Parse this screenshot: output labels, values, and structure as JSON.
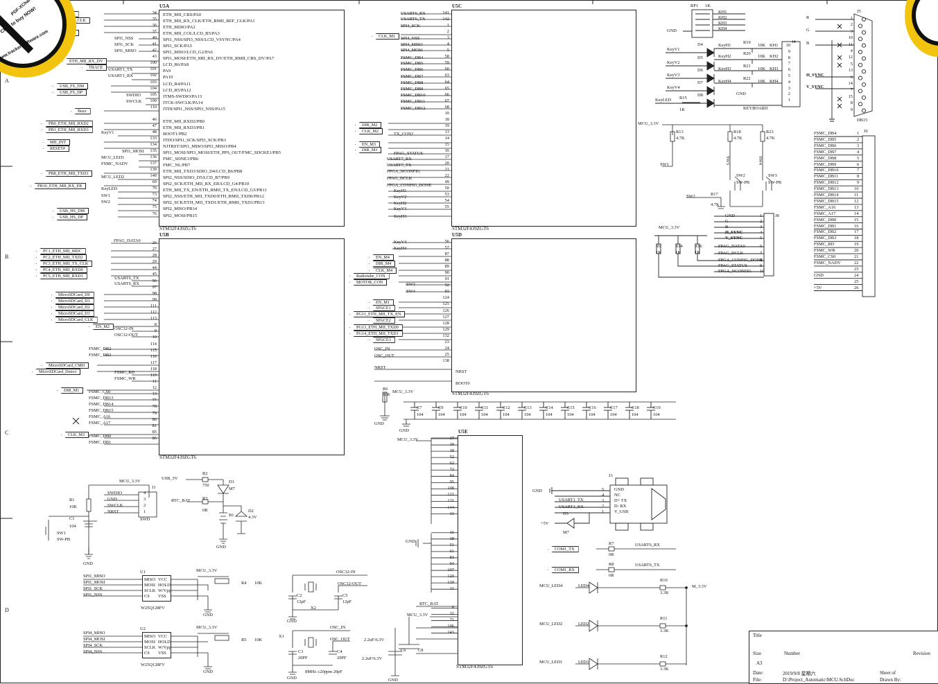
{
  "watermark": {
    "text": "Click to buy NOW!",
    "url_text": "www.tracker-software.com",
    "brand": "PDF-XChange"
  },
  "zones": [
    "A",
    "B",
    "C",
    "D"
  ],
  "u5a": {
    "title": "U5A",
    "part": "STM32F439ZGT6",
    "pins": [
      "ETH_MII_CRS/PA0",
      "ETH_MII_RX_CLK/ETH_RMII_REF_CLK/PA1",
      "ETH_MDIO/PA2",
      "ETH_MII_COL/LCD_B5/PA3",
      "SPI1_NSS/SPI3_NSS/LCD_VSYNC/PA4",
      "SPI1_SCK/PA5",
      "SPI1_MISO/LCD_G2/PA6",
      "SPI1_MOSI/ETH_MII_RX_DV/ETH_RMII_CRS_DV/PA7",
      "LCD_R6/PA8",
      "PA9",
      "PA10",
      "LCD_R4/PA11",
      "LCD_R5/PA12",
      "JTMS-SWDIO/PA13",
      "JTCK-SWCLK/PA14",
      "JTDI/SPI1_NSS/SPI3_NSS/PA15",
      "",
      "ETH_MII_RXD2/PB0",
      "ETH_MII_RXD3/PB1",
      "BOOT1/PB2",
      "JTDO/SPI1_SCK/SPI3_SCK/PB3",
      "NJTRST/SPI1_MISO/SPI3_MISO/PB4",
      "SPI1_MOSI/SPI3_MOSI/ETH_PPS_OUT/FMC_SDCKE1/PB5",
      "FMC_SDNE1/PB6",
      "FMC_NL/PB7",
      "ETH_MII_TXD3/SDIO_D4/LCD_B6/PB8",
      "SPI2_NSS/SDIO_D5/LCD_B7/PB9",
      "SPI2_SCK/ETH_MII_RX_ER/LCD_G4/PB10",
      "ETH_MII_TX_EN/ETH_RMII_TX_EN/LCD_G5/PB11",
      "SPI2_NSS/ETH_MII_TXD0/ETH_RMII_TXD0/PB12",
      "SPI2_SCK/ETH_MII_TXD1/ETH_RMII_TXD1/PB13",
      "SPI2_MISO/PB14",
      "SPI2_MOSI/PB15"
    ],
    "nums": [
      "34",
      "35",
      "36",
      "37",
      "40",
      "41",
      "42",
      "43",
      "100",
      "101",
      "102",
      "103",
      "104",
      "105",
      "109",
      "110",
      "",
      "46",
      "47",
      "48",
      "133",
      "134",
      "135",
      "136",
      "137",
      "139",
      "140",
      "69",
      "70",
      "73",
      "74",
      "75",
      "76"
    ]
  },
  "u5a_nets": [
    {
      "t": "ETH_MII_CRS"
    },
    {
      "t": "ETH_MII_RX_CLK"
    },
    {
      "t": "ETH_MDIO"
    },
    {
      "t": "ETH_MII_COL"
    },
    {
      "t": "SPI1_NSS"
    },
    {
      "t": "SPI1_SCK"
    },
    {
      "t": "SPI1_MISO"
    },
    {
      "t": "ETH_MII_RX_DV"
    },
    {
      "t": "TRACE"
    },
    {
      "t": "USART1_TX"
    },
    {
      "t": "USART1_RX"
    },
    {
      "t": "USB_FS_DM"
    },
    {
      "t": "USB_FS_DP"
    },
    {
      "t": "SWDIO"
    },
    {
      "t": "SWCLK"
    },
    {
      "t": "Buzz"
    },
    {
      "t": "PB0_ETH_MII_RXD2"
    },
    {
      "t": "PB1_ETH_MII_RXD3"
    },
    {
      "t": "KeyV1"
    },
    {
      "t": "MII_INT"
    },
    {
      "t": "RESET#"
    },
    {
      "t": "SPI1_MOSI"
    },
    {
      "t": "MCU_LED1"
    },
    {
      "t": "FSMC_NADV"
    },
    {
      "t": "PB8_ETH_MII_TXD3"
    },
    {
      "t": "MCU_LED2"
    },
    {
      "t": "PB10_ETH_MII_RX_ER"
    },
    {
      "t": "KeyLED"
    },
    {
      "t": "SW1"
    },
    {
      "t": "SW2"
    },
    {
      "t": "USB_HS_DM"
    },
    {
      "t": "USB_HS_DP"
    }
  ],
  "u5b": {
    "title": "U5B",
    "part": "STM32F439ZGT6",
    "nets": [
      "FPAG_DATA0",
      "PC1_ETH_MII_MDC",
      "PC2_ETH_MII_TXD2",
      "PC3_ETH_MII_TX_CLK",
      "PC4_ETH_MII_RXD0",
      "PC5_ETH_MII_RXD1",
      "USART6_TX",
      "USART6_RX",
      "MicroSDCard_D0",
      "MicroSDCard_D1",
      "MicroSDCard_D2",
      "MicroSDCard_D3",
      "MicroSDCard_CLK",
      "EN_M2",
      "OSC32-IN",
      "OSC32-OUT",
      "FSMC_DB2",
      "FSMC_DB3",
      "MicroSDCard_CMD",
      "MicroSDCard_Detect",
      "FSMC_RD",
      "FSMC_WR",
      "DIR_M1",
      "FSMC_CS0",
      "FSMC_DB13",
      "FSMC_DB14",
      "FSMC_DB15",
      "FSMC_A16",
      "FSMC_A17",
      "CLK_M3",
      "FSMC_DB0",
      "FSMC_DB1"
    ],
    "nums": [
      "26",
      "27",
      "28",
      "29",
      "44",
      "45",
      "96",
      "97",
      "98",
      "99",
      "111",
      "112",
      "113",
      "8",
      "9",
      "10",
      "114",
      "115",
      "116",
      "117",
      "118",
      "119",
      "11",
      "12",
      "13",
      "77",
      "78",
      "79",
      "80",
      "81",
      "85",
      "86"
    ]
  },
  "u5c": {
    "title": "U5C",
    "part": "STM32F439ZGT6",
    "nets_left": [
      "USART6_RX",
      "USART6_TX",
      "SPI4_SCK",
      "CLK_M1",
      "SPI4_NSS",
      "SPI4_MISO",
      "SPI4_MOSI",
      "FSMC_DB4",
      "FSMC_DB5",
      "FSMC_DB6",
      "FSMC_DB7",
      "FSMC_DB8",
      "FSMC_DB9",
      "FSMC_DB10",
      "FSMC_DB11",
      "FSMC_DB12",
      "DIR_M2",
      "CLK_M2",
      "TX_CON2",
      "EN_M3",
      "DIR_M3",
      "FPAG_STATUS",
      "USART7_RX",
      "USART7_TX",
      "FPGA_NCONFIG",
      "FPAG_DCLK",
      "FPGA_CONFIG_DONE",
      "KeyH1",
      "KeyV2",
      "KeyH2",
      "KeyV3",
      "KeyH3"
    ],
    "nums": [
      "141",
      "142",
      "1",
      "2",
      "3",
      "4",
      "5",
      "58",
      "59",
      "60",
      "63",
      "64",
      "65",
      "66",
      "67",
      "68",
      "10",
      "18",
      "19",
      "13",
      "14",
      "15",
      "16",
      "17",
      "20",
      "21",
      "22",
      "49",
      "50",
      "53",
      "54",
      "55"
    ]
  },
  "u5d": {
    "title": "U5D",
    "part": "STM32F439ZGT6",
    "nets_left": [
      "KeyV4",
      "KeyH4",
      "EN_M4",
      "DIR_M4",
      "CLK_M4",
      "Radiotube_CON",
      "MOTOR_CON",
      "SW3",
      "SW4",
      "EN_M1",
      "SPACE1",
      "PG11_ETH_MII_TX_EN",
      "SPACE2",
      "PG13_ETH_MII_TXD0",
      "PG14_ETH_MII_TXD1",
      "SPACE3",
      "OSC_IN",
      "OSC_OUT",
      "NRST",
      "BOOT0"
    ],
    "nums": [
      "56",
      "57",
      "87",
      "88",
      "89",
      "90",
      "91",
      "92",
      "93",
      "124",
      "125",
      "126",
      "127",
      "128",
      "129",
      "132",
      "23",
      "24",
      "25",
      "138"
    ]
  },
  "u5e": {
    "title": "U5E",
    "part": "STM32F439ZGT6",
    "vdd_pins": [
      "17",
      "30",
      "39",
      "52",
      "62",
      "72",
      "84",
      "95",
      "108",
      "121",
      "131",
      "144",
      "33"
    ],
    "vss_pins": [
      "16",
      "38",
      "51",
      "61",
      "83",
      "94",
      "107",
      "120",
      "130",
      "31"
    ],
    "other_pins": [
      "6",
      "32",
      "71",
      "106",
      "143"
    ],
    "mcu": "MCU_3.3V",
    "gnd": "GND",
    "rtc": "RTC_BAT",
    "cap_a": "2.2uF/6.3V",
    "cap_b": "2.2uF/6.3V",
    "c6": "C6",
    "c8": "C8"
  },
  "decoupling": {
    "caps": [
      "C7",
      "C9",
      "C10",
      "C11",
      "C12",
      "C13",
      "C14",
      "C15",
      "C16",
      "C17",
      "C18",
      "C19"
    ],
    "value": "104",
    "r6": "R6",
    "r6_val": "10K",
    "mcu": "MCU_3.3V",
    "gnd": "GND"
  },
  "db15": {
    "title": "J5",
    "part": "DB15",
    "nets": [
      "R",
      "G",
      "B",
      "H_SYNC",
      "V_SYNC"
    ],
    "pins": [
      "1",
      "2",
      "3",
      "10",
      "11",
      "4",
      "12",
      "5",
      "13",
      "6",
      "14",
      "7",
      "15",
      "8",
      "9"
    ]
  },
  "rp1": {
    "name": "RP1",
    "val": "1K",
    "gnd": "GND",
    "outs": [
      "KH1",
      "KH2",
      "KH3",
      "KH4"
    ]
  },
  "keyboard": {
    "title": "KEYBOARD",
    "j4": "J4",
    "vnets": [
      "KeyV1",
      "KeyV2",
      "KeyV3",
      "KeyV4",
      "KeyLED"
    ],
    "diodes": [
      "D4",
      "D5",
      "D6",
      "D7",
      "D8"
    ],
    "hnets": [
      "KeyH1",
      "KeyH2",
      "KeyH3",
      "KeyH4"
    ],
    "resistors": [
      "R19",
      "R20",
      "R21",
      "R22"
    ],
    "rvals": [
      "10K",
      "10K",
      "10K",
      "10K"
    ],
    "kh": [
      "KH1",
      "KH2",
      "KH3",
      "KH4"
    ],
    "pins": [
      "10",
      "9",
      "8",
      "7",
      "6",
      "5",
      "4",
      "3",
      "2",
      "1"
    ],
    "r15": "R15",
    "r15_val": "1K",
    "gnd": "GND"
  },
  "switches": {
    "mcu": "MCU_3.3V",
    "r13": "R13",
    "r13v": "4.7K",
    "r18": "R18",
    "r18v": "4.7K",
    "r23": "R23",
    "r23v": "4.7K",
    "r17": "R17",
    "r17v": "4.7K",
    "sw1": "SW1",
    "sw2": "SW2",
    "sw3": "SW3",
    "sw4": "SW4",
    "sw2l": "SW2",
    "sw3l": "SW3",
    "type": "SW-PB"
  },
  "j36": {
    "title": "J6",
    "nets": [
      "FSMC_DB4",
      "FSMC_DB5",
      "FSMC_DB6",
      "FSMC_DB7",
      "FSMC_DB8",
      "FSMC_DB9",
      "FSMC_DB10",
      "FSMC_DB11",
      "FSMC_DB12",
      "FSMC_DB13",
      "FSMC_DB14",
      "FSMC_DB15",
      "FSMC_A16",
      "FSMC_A17",
      "FSMC_DB0",
      "FSMC_DB1",
      "FSMC_DB2",
      "FSMC_DB3",
      "FSMC_RD",
      "FSMC_WR",
      "FSMC_CS0",
      "FSMC_NADV",
      "",
      "GND",
      "",
      "+5V"
    ],
    "pins": [
      "1",
      "2",
      "3",
      "4",
      "5",
      "6",
      "7",
      "8",
      "9",
      "10",
      "11",
      "12",
      "13",
      "14",
      "15",
      "16",
      "17",
      "18",
      "19",
      "20",
      "21",
      "22",
      "23",
      "24",
      "25",
      "26"
    ]
  },
  "j8": {
    "title": "J8",
    "mcu": "MCU_3.3V",
    "r9": "R9",
    "r9v": "1K",
    "r14": "R14",
    "r14v": "1K",
    "r16": "R16",
    "r16v": "1K",
    "nets": [
      "GND",
      "G",
      "B",
      "H_SYNC",
      "V_SYNC",
      "FPAG_DATA0",
      "FPAG_DCLK",
      "FPGA_CONFIG_DONE",
      "FPAG_STATUS",
      "FPGA_NCONFIG"
    ],
    "pins": [
      "1",
      "2",
      "3",
      "4",
      "5",
      "6",
      "7",
      "8",
      "9",
      "10"
    ]
  },
  "swd": {
    "mcu": "MCU_3.3V",
    "r1": "R1",
    "r1v": "10K",
    "c1": "C1",
    "c1v": "104",
    "sw1": "SW1",
    "sw1t": "SW-PB",
    "gnd": "GND",
    "j1": "J1",
    "pins": [
      "SWDIO",
      "GND",
      "SWCLK",
      "NRST"
    ],
    "nums": [
      "4",
      "3",
      "2",
      "1"
    ],
    "label": "SWD"
  },
  "rtc": {
    "usb5v": "USB_5V",
    "r2": "R2",
    "r2v": "750",
    "d1": "D1",
    "d1v": "M7",
    "rtcbat": "RTC_BAT",
    "r3": "R3",
    "r3v": "0R",
    "b1": "B1",
    "d2": "D2",
    "d2v": "4.3V",
    "gnd": "GND"
  },
  "flash": [
    {
      "u": "U1",
      "part": "W25Q128FV",
      "nets": [
        "SPI1_MISO",
        "SPI1_MOSI",
        "SPI1_SCK",
        "SPI1_NSS"
      ],
      "r": "R4",
      "rv": "10K"
    },
    {
      "u": "U2",
      "part": "W25Q128FV",
      "nets": [
        "SPI4_MISO",
        "SPI4_MOSI",
        "SPI4_SCK",
        "SPI4_NSS"
      ],
      "r": "R5",
      "rv": "10K"
    }
  ],
  "flash_pins": {
    "left": [
      "MISO",
      "MOSI",
      "SCLK",
      "CS"
    ],
    "right": [
      "VCC",
      "HOLD",
      "W/Vpp",
      "VSS"
    ],
    "mcu": "MCU_3.3V",
    "gnd": "GND"
  },
  "osc": {
    "osc32in": "OSC32-IN",
    "osc32out": "OSC32-OUT",
    "c2": "C2",
    "c2v": "12pF",
    "c5": "C5",
    "c5v": "12pF",
    "x2": "X2",
    "oscin": "OSC_IN",
    "oscout": "OSC_OUT",
    "x1": "X1",
    "c3": "C3",
    "c3v": "20PF",
    "c4": "C4",
    "c4v": "20PF",
    "xtal": "8MHz ±20ppm 20pF",
    "gnd": "GND"
  },
  "usb": {
    "j3": "J3",
    "gnd": "GND",
    "p5v": "+5V",
    "d3": "D3",
    "d3v": "M7",
    "usart_tx": "USART1_TX",
    "usart_rx": "USART1_RX",
    "pins": [
      "GND",
      "NC",
      "D+ TX",
      "D- RX",
      "V_USB"
    ],
    "nums": [
      "5",
      "4",
      "3",
      "2",
      "1"
    ]
  },
  "com": {
    "tx": "COM1_TX",
    "rx": "COM1_RX",
    "r7": "R7",
    "r7v": "0R",
    "r8": "R8",
    "r8v": "0R",
    "u6rx": "USART6_RX",
    "u6tx": "USART6_TX"
  },
  "leds": [
    {
      "net": "MCU_LED4",
      "led": "LED4",
      "r": "R10",
      "rv": "3.3K"
    },
    {
      "net": "MCU_LED2",
      "led": "LED2",
      "r": "R11",
      "rv": "3.3K"
    },
    {
      "net": "MCU_LED1",
      "led": "LED1",
      "r": "R12",
      "rv": "3.3K"
    }
  ],
  "led_rail": "M_3.3V",
  "titleblock": {
    "title": "Title",
    "size": "Size",
    "size_v": "A3",
    "number": "Number",
    "revision": "Revision",
    "date": "Date:",
    "date_v": "2019/9/8 星期六",
    "sheet": "Sheet   of",
    "file": "File:",
    "file_v": "D:\\Project_Automatic\\MCU.SchDoc",
    "drawn": "Drawn By:"
  }
}
